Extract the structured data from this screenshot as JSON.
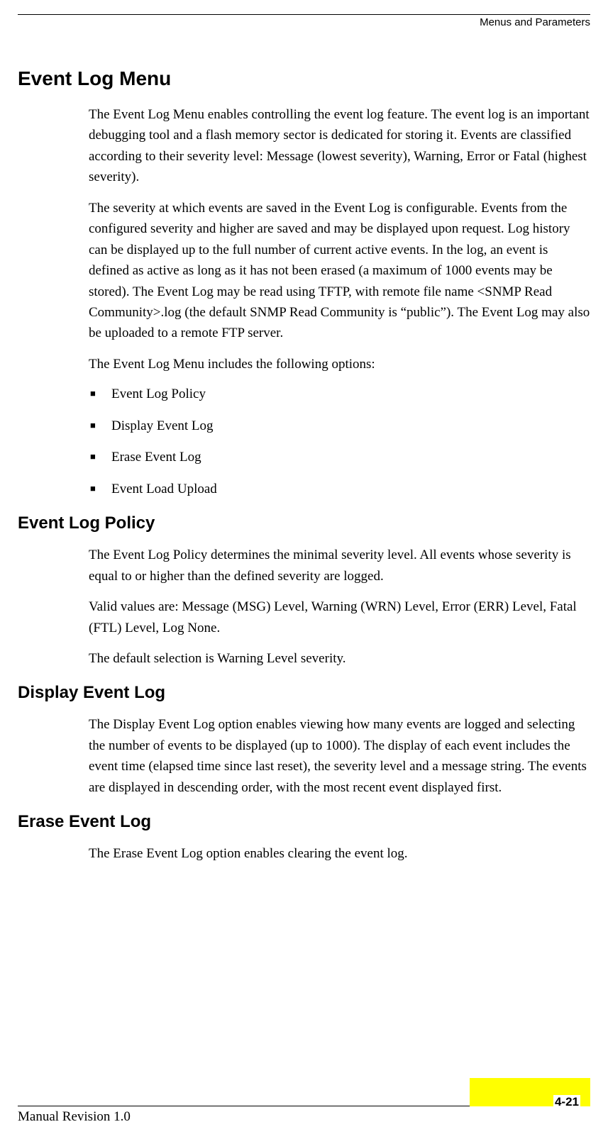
{
  "header": {
    "section_title": "Menus and Parameters"
  },
  "h1": "Event Log Menu",
  "p1": "The Event Log Menu enables controlling the event log feature. The event log is an important debugging tool and a flash memory sector is dedicated for storing it. Events are classified according to their severity level: Message (lowest severity), Warning, Error or Fatal (highest severity).",
  "p2": "The severity at which events are saved in the Event Log is configurable. Events from the configured severity and higher are saved and may be displayed upon request. Log history can be displayed up to the full number of current active events. In the log, an event is defined as active as long as it has not been erased (a maximum of 1000 events may be stored). The Event Log may be read using TFTP, with remote file name <SNMP Read Community>.log (the default SNMP Read Community is “public”). The Event Log may also be uploaded to a remote FTP server.",
  "p3": "The Event Log Menu includes the following options:",
  "options": {
    "0": "Event Log Policy",
    "1": "Display Event Log",
    "2": "Erase Event Log",
    "3": "Event Load Upload"
  },
  "h2_policy": "Event Log Policy",
  "p_policy_1": "The Event Log Policy determines the minimal severity level. All events whose severity is equal to or higher than the defined severity are logged.",
  "p_policy_2": "Valid values are: Message (MSG) Level, Warning (WRN) Level, Error (ERR) Level, Fatal (FTL) Level, Log None.",
  "p_policy_3": "The default selection is Warning Level severity.",
  "h2_display": "Display Event Log",
  "p_display_1": "The Display Event Log option enables viewing how many events are logged and selecting the number of events to be displayed (up to 1000). The display of each event includes the event time (elapsed time since last reset), the severity level and a message string. The events are displayed in descending order, with the most recent event displayed first.",
  "h2_erase": "Erase Event Log",
  "p_erase_1": "The Erase Event Log option enables clearing the event log.",
  "footer": {
    "revision": "Manual Revision 1.0",
    "page": "4-21"
  }
}
